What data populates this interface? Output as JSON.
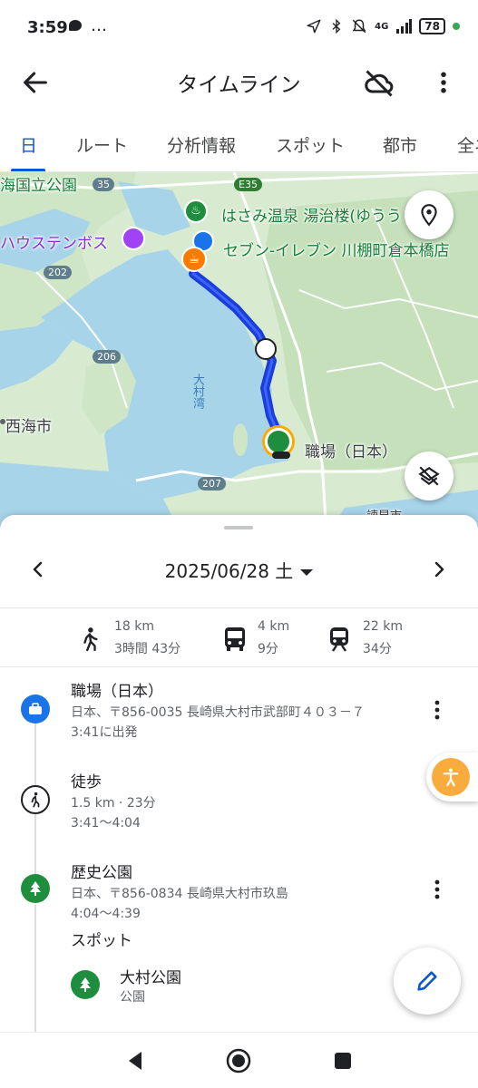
{
  "status_bar": {
    "time": "3:59",
    "dots": "…",
    "network": "4G",
    "battery": "78"
  },
  "app_bar": {
    "title": "タイムライン"
  },
  "tabs": [
    {
      "label": "日",
      "active": true
    },
    {
      "label": "ルート"
    },
    {
      "label": "分析情報"
    },
    {
      "label": "スポット"
    },
    {
      "label": "都市"
    },
    {
      "label": "全ネ"
    }
  ],
  "map": {
    "labels": {
      "national_park": "海国立公園",
      "huis_ten_bosch": "ハウステンボス",
      "hasami_onsen": "はさみ温泉 湯治楼(ゆうう",
      "seven_eleven": "セブン-イレブン 川棚町倉本橋店",
      "omura_bay": "大村湾",
      "saikai": "西海市",
      "workplace": "職場（日本）",
      "isahaya": "諫早市"
    },
    "routes": [
      "E35",
      "35",
      "202",
      "206",
      "207"
    ],
    "colors": {
      "route_line": "#1a3fd9",
      "water": "#a8d4ea",
      "land": "#d8ebd1"
    }
  },
  "sheet": {
    "date": "2025/06/28 土",
    "summary": [
      {
        "icon": "walk-icon",
        "distance": "18 km",
        "duration": "3時間 43分"
      },
      {
        "icon": "bus-icon",
        "distance": "4 km",
        "duration": "9分"
      },
      {
        "icon": "train-icon",
        "distance": "22 km",
        "duration": "34分"
      }
    ],
    "timeline": {
      "workplace": {
        "title": "職場（日本）",
        "address": "日本、〒856-0035 長崎県大村市武部町４０３－７",
        "time": "3:41に出発"
      },
      "walk": {
        "title": "徒歩",
        "detail": "1.5 km · 23分",
        "time": "3:41〜4:04"
      },
      "park": {
        "title": "歴史公園",
        "address": "日本、〒856-0834 長崎県大村市玖島",
        "time": "4:04〜4:39"
      },
      "spots_header": "スポット",
      "spot": {
        "name": "大村公園",
        "category": "公園"
      }
    }
  }
}
